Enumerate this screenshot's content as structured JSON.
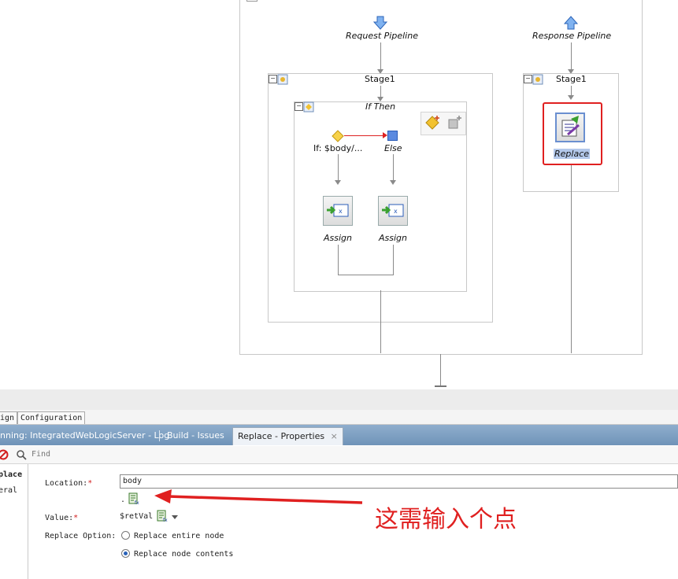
{
  "pipeline": {
    "request_label": "Request Pipeline",
    "response_label": "Response Pipeline",
    "request_stage": "Stage1",
    "response_stage": "Stage1",
    "ifthen_label": "If Then",
    "if_condition": "If: $body/...",
    "else_label": "Else",
    "assign_left": "Assign",
    "assign_right": "Assign",
    "replace_label": "Replace"
  },
  "bottom_tabs": {
    "design_partial": "ign",
    "configuration": "Configuration"
  },
  "log_tabs": {
    "running_log": "nning: IntegratedWebLogicServer - Log",
    "build_issues": "Build - Issues",
    "properties": "Replace - Properties",
    "close_glyph": "×"
  },
  "toolbar": {
    "find_placeholder": "Find"
  },
  "properties": {
    "nav_replace": "place",
    "nav_general": "eral",
    "location_label": "Location:",
    "required_mark": "*",
    "location_value": "body",
    "dot_value": ".",
    "value_label": "Value:",
    "value_text": "$retVal",
    "replace_option_label": "Replace Option:",
    "option_entire": "Replace entire node",
    "option_contents": "Replace node contents",
    "selected_option": "contents"
  },
  "annotation": {
    "note": "这需输入个点"
  },
  "colors": {
    "highlight_red": "#e02020",
    "tab_blue": "#7a9dc2",
    "select_blue": "#b3c8ea"
  }
}
